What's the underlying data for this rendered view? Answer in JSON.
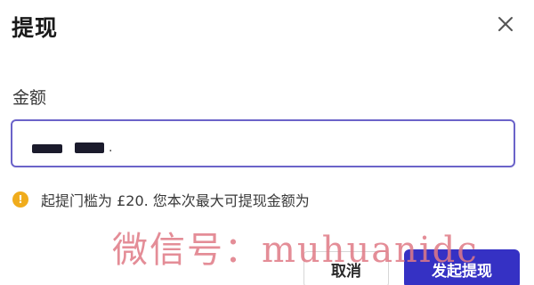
{
  "dialog": {
    "title": "提现",
    "close_icon": "close-icon"
  },
  "amount": {
    "label": "金额",
    "value_suffix": "."
  },
  "notice": {
    "icon": "warning-icon",
    "icon_glyph": "!",
    "text": "起提门槛为 £20. 您本次最大可提现金额为"
  },
  "actions": {
    "cancel_label": "取消",
    "submit_label": "发起提现"
  },
  "watermark": {
    "text": "微信号：muhuanidc"
  },
  "colors": {
    "accent": "#3531c4",
    "input_border": "#6b63c9",
    "warning": "#f0ac1c",
    "watermark": "#e07a86"
  }
}
